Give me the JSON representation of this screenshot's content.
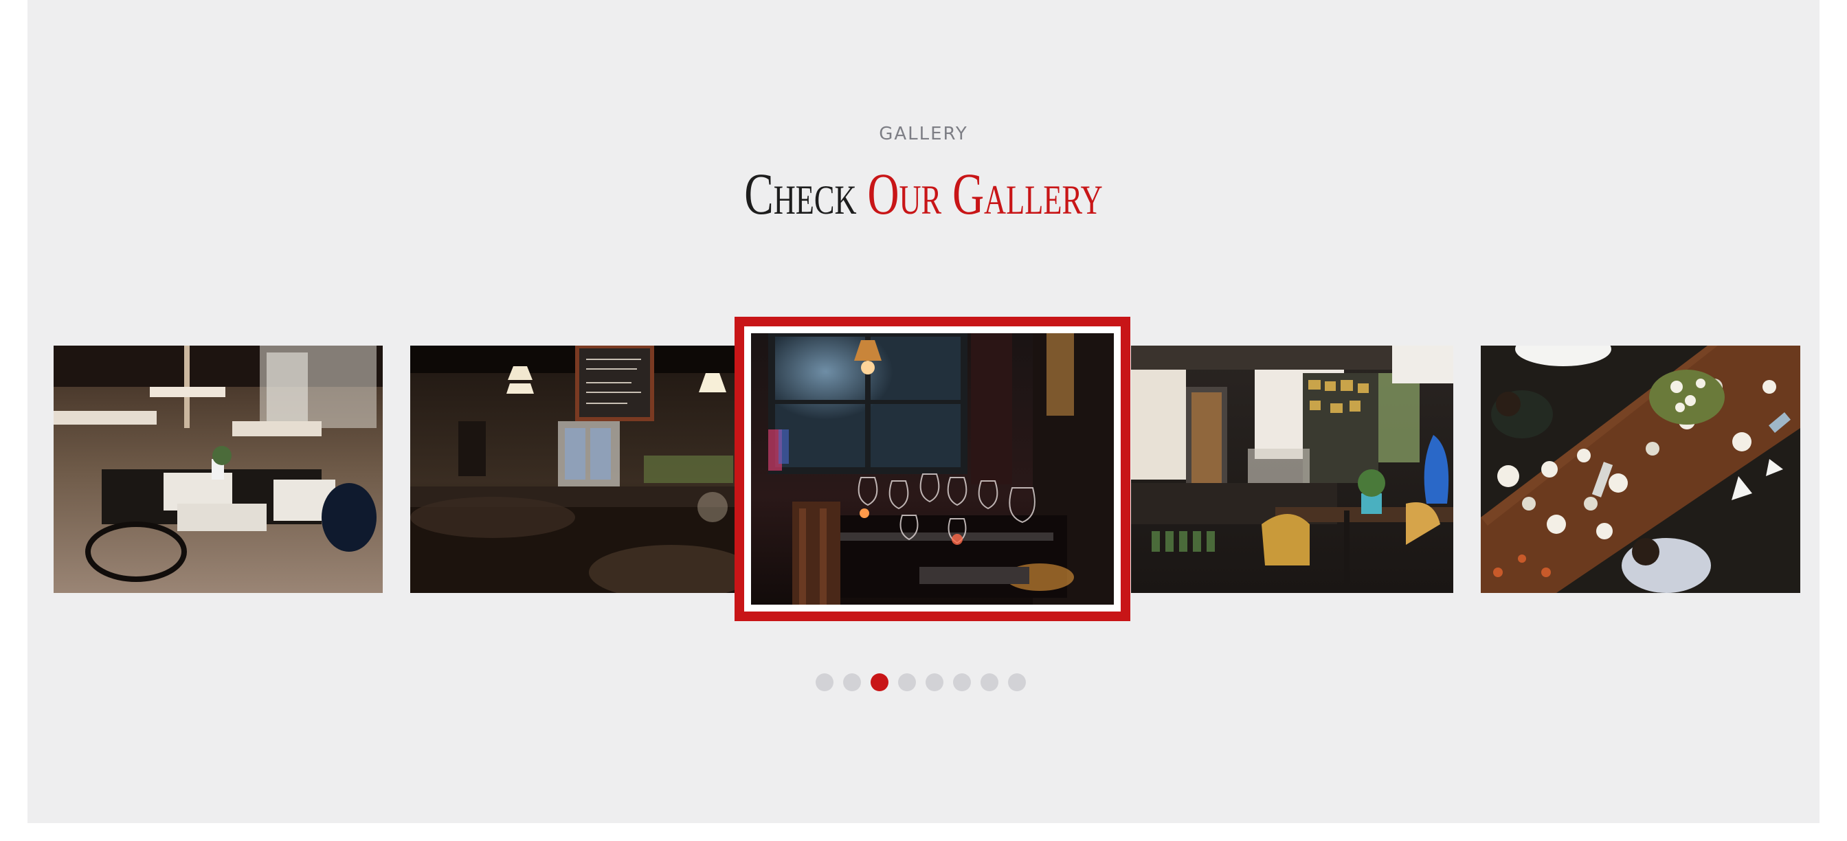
{
  "gallery": {
    "kicker": "GALLERY",
    "title_part1": "Check",
    "title_part2": "Our Gallery",
    "accent_color": "#c81517",
    "slides": [
      {
        "label": "restaurant-dining-room-photo"
      },
      {
        "label": "bar-with-chalkboard-menu-photo"
      },
      {
        "label": "table-with-wine-glasses-photo"
      },
      {
        "label": "cafe-counter-with-fridges-photo"
      },
      {
        "label": "overhead-dinner-table-photo"
      }
    ],
    "active_slide_index": 2,
    "pagination": {
      "count": 8,
      "active_index": 2
    }
  }
}
